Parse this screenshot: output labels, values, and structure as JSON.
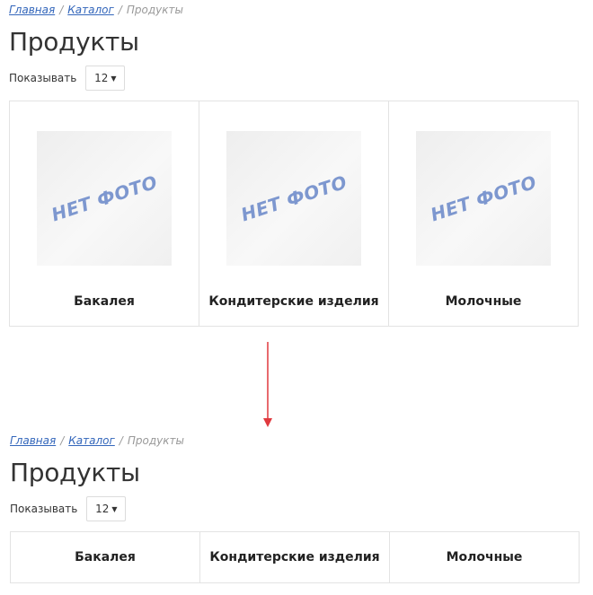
{
  "before": {
    "breadcrumb": {
      "home": "Главная",
      "catalog": "Каталог",
      "current": "Продукты",
      "separator": "/"
    },
    "page_title": "Продукты",
    "show_label": "Показывать",
    "per_page": "12",
    "products": [
      {
        "name": "Бакалея",
        "photo_placeholder": "НЕТ ФОТО"
      },
      {
        "name": "Кондитерские изделия",
        "photo_placeholder": "НЕТ ФОТО"
      },
      {
        "name": "Молочные",
        "photo_placeholder": "НЕТ ФОТО"
      }
    ]
  },
  "after": {
    "breadcrumb": {
      "home": "Главная",
      "catalog": "Каталог",
      "current": "Продукты",
      "separator": "/"
    },
    "page_title": "Продукты",
    "show_label": "Показывать",
    "per_page": "12",
    "products": [
      {
        "name": "Бакалея"
      },
      {
        "name": "Кондитерские изделия"
      },
      {
        "name": "Молочные"
      }
    ]
  },
  "colors": {
    "link": "#3366bb",
    "arrow": "#e0393e",
    "placeholder_text": "#7d97cf",
    "border": "#e3e3e3"
  },
  "icons": {
    "dropdown": "caret-down-icon",
    "arrow": "arrow-down-icon"
  }
}
